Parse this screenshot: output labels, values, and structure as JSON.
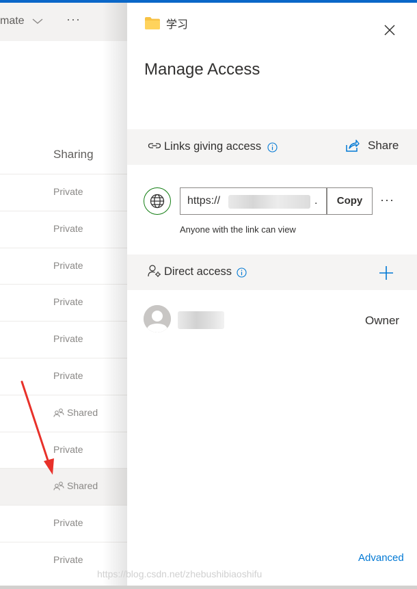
{
  "background_list": {
    "toolbar": {
      "format_label": "mate",
      "more_label": "···"
    },
    "column_header": "Sharing",
    "rows": [
      {
        "value": "Private",
        "shared": false,
        "selected": false
      },
      {
        "value": "Private",
        "shared": false,
        "selected": false
      },
      {
        "value": "Private",
        "shared": false,
        "selected": false
      },
      {
        "value": "Private",
        "shared": false,
        "selected": false
      },
      {
        "value": "Private",
        "shared": false,
        "selected": false
      },
      {
        "value": "Private",
        "shared": false,
        "selected": false
      },
      {
        "value": "Shared",
        "shared": true,
        "selected": false
      },
      {
        "value": "Private",
        "shared": false,
        "selected": false
      },
      {
        "value": "Shared",
        "shared": true,
        "selected": true
      },
      {
        "value": "Private",
        "shared": false,
        "selected": false
      },
      {
        "value": "Private",
        "shared": false,
        "selected": false
      }
    ]
  },
  "panel": {
    "folder_name": "学习",
    "title": "Manage Access",
    "links_section": {
      "label": "Links giving access",
      "share_label": "Share"
    },
    "link": {
      "url_visible": "https://",
      "url_tail": ".",
      "copy_label": "Copy",
      "more_label": "···",
      "caption": "Anyone with the link can view"
    },
    "direct_section": {
      "label": "Direct access"
    },
    "owner_role": "Owner",
    "advanced_label": "Advanced"
  },
  "watermark": "https://blog.csdn.net/zhebushibiaoshifu",
  "colors": {
    "accent": "#0a67c8",
    "link_blue": "#0078d4",
    "globe_green": "#107c10",
    "annotation_red": "#e8312a"
  },
  "icons": {
    "folder": "folder-icon",
    "close": "close-icon",
    "link": "link-icon",
    "info": "info-icon",
    "share": "share-icon",
    "globe": "globe-icon",
    "person_settings": "person-settings-icon",
    "add": "add-icon",
    "avatar": "avatar-icon",
    "shared_people": "shared-people-icon"
  }
}
